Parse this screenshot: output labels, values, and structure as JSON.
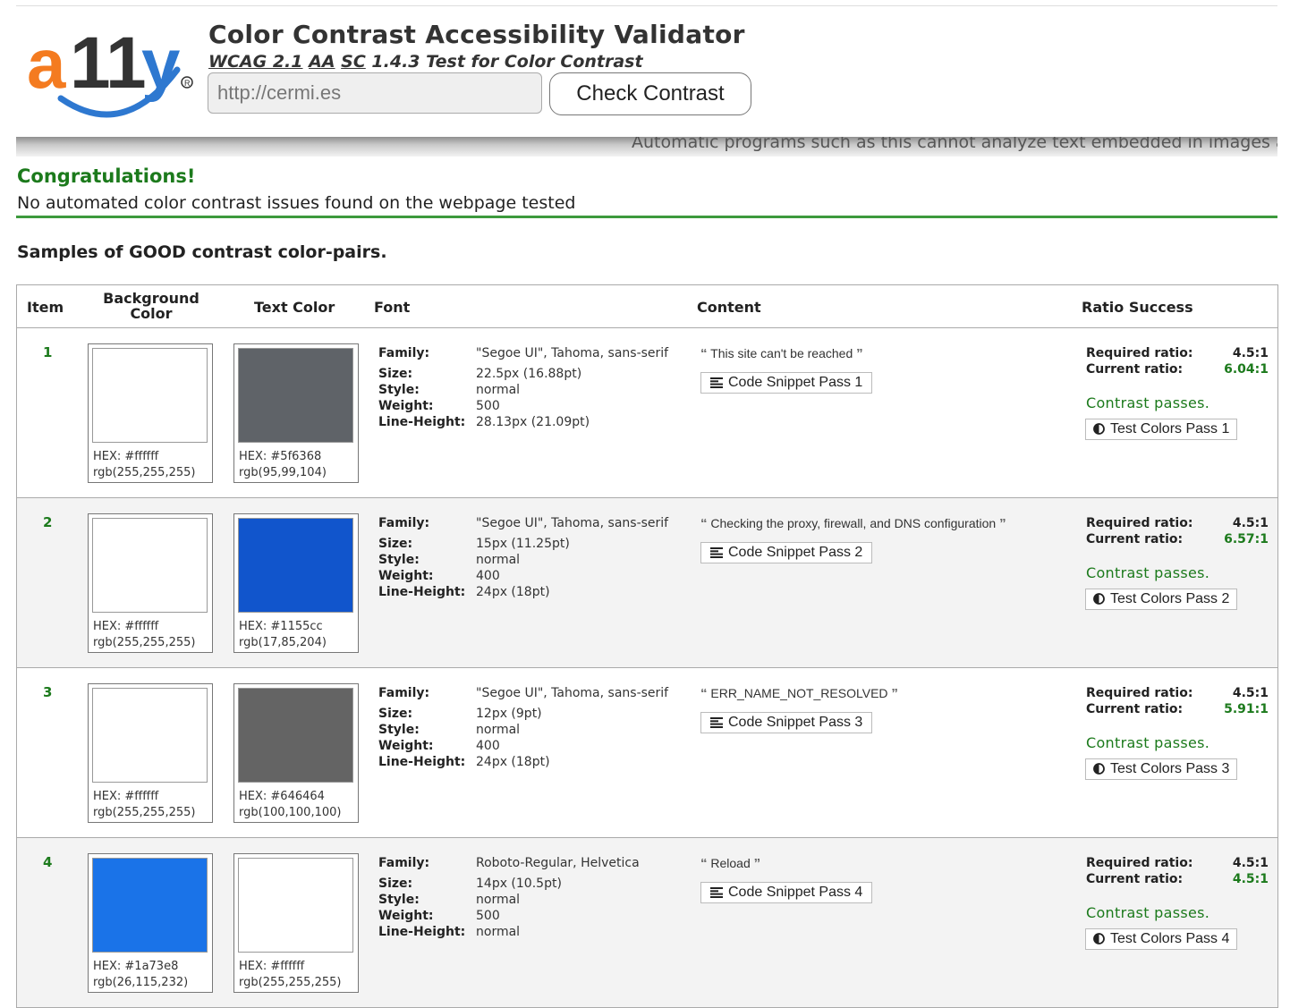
{
  "header": {
    "logo_text": "a11y",
    "title": "Color Contrast Accessibility Validator",
    "subtitle_parts": [
      "WCAG 2.1",
      "AA",
      "SC",
      "1.4.3 Test for Color Contrast"
    ],
    "url_value": "http://cermi.es",
    "check_button": "Check Contrast",
    "marquee": "Automatic programs such as this cannot analyze text embedded in images a"
  },
  "result": {
    "heading": "Congratulations!",
    "message": "No automated color contrast issues found on the webpage tested"
  },
  "samples_title": "Samples of GOOD contrast color-pairs.",
  "table": {
    "headers": {
      "item": "Item",
      "background_color": "Background Color",
      "text_color": "Text Color",
      "font": "Font",
      "content": "Content",
      "ratio_success": "Ratio Success"
    },
    "font_labels": {
      "family": "Family:",
      "size": "Size:",
      "style": "Style:",
      "weight": "Weight:",
      "line_height": "Line-Height:"
    },
    "ratio_labels": {
      "required": "Required ratio:",
      "current": "Current ratio:"
    },
    "rows": [
      {
        "item": "1",
        "bg": {
          "hex": "HEX: #ffffff",
          "rgb": "rgb(255,255,255)",
          "color": "#ffffff"
        },
        "fg": {
          "hex": "HEX: #5f6368",
          "rgb": "rgb(95,99,104)",
          "color": "#5f6368"
        },
        "family": "\"Segoe UI\", Tahoma, sans-serif",
        "size": "22.5px (16.88pt)",
        "style": "normal",
        "weight": "500",
        "line_height": "28.13px (21.09pt)",
        "content": "This site can't be reached",
        "snippet": "Code Snippet Pass 1",
        "required": "4.5:1",
        "current": "6.04:1",
        "passes": "Contrast passes.",
        "test": "Test Colors Pass 1"
      },
      {
        "item": "2",
        "bg": {
          "hex": "HEX: #ffffff",
          "rgb": "rgb(255,255,255)",
          "color": "#ffffff"
        },
        "fg": {
          "hex": "HEX: #1155cc",
          "rgb": "rgb(17,85,204)",
          "color": "#1155cc"
        },
        "family": "\"Segoe UI\", Tahoma, sans-serif",
        "size": "15px (11.25pt)",
        "style": "normal",
        "weight": "400",
        "line_height": "24px (18pt)",
        "content": "Checking the proxy, firewall, and DNS configuration",
        "snippet": "Code Snippet Pass 2",
        "required": "4.5:1",
        "current": "6.57:1",
        "passes": "Contrast passes.",
        "test": "Test Colors Pass 2"
      },
      {
        "item": "3",
        "bg": {
          "hex": "HEX: #ffffff",
          "rgb": "rgb(255,255,255)",
          "color": "#ffffff"
        },
        "fg": {
          "hex": "HEX: #646464",
          "rgb": "rgb(100,100,100)",
          "color": "#646464"
        },
        "family": "\"Segoe UI\", Tahoma, sans-serif",
        "size": "12px (9pt)",
        "style": "normal",
        "weight": "400",
        "line_height": "24px (18pt)",
        "content": "ERR_NAME_NOT_RESOLVED",
        "snippet": "Code Snippet Pass 3",
        "required": "4.5:1",
        "current": "5.91:1",
        "passes": "Contrast passes.",
        "test": "Test Colors Pass 3"
      },
      {
        "item": "4",
        "bg": {
          "hex": "HEX: #1a73e8",
          "rgb": "rgb(26,115,232)",
          "color": "#1a73e8"
        },
        "fg": {
          "hex": "HEX: #ffffff",
          "rgb": "rgb(255,255,255)",
          "color": "#ffffff"
        },
        "family": "Roboto-Regular, Helvetica",
        "size": "14px (10.5pt)",
        "style": "normal",
        "weight": "500",
        "line_height": "normal",
        "content": "Reload",
        "snippet": "Code Snippet Pass 4",
        "required": "4.5:1",
        "current": "4.5:1",
        "passes": "Contrast passes.",
        "test": "Test Colors Pass 4"
      }
    ]
  },
  "icons": {
    "quote_open": "“",
    "quote_close": "”",
    "snippet_icon": "align-left-icon",
    "contrast_icon": "adjust-icon"
  },
  "colors": {
    "pass_green": "#1c7a1c",
    "logo_orange": "#f47b20",
    "logo_blue": "#2e78d0"
  }
}
